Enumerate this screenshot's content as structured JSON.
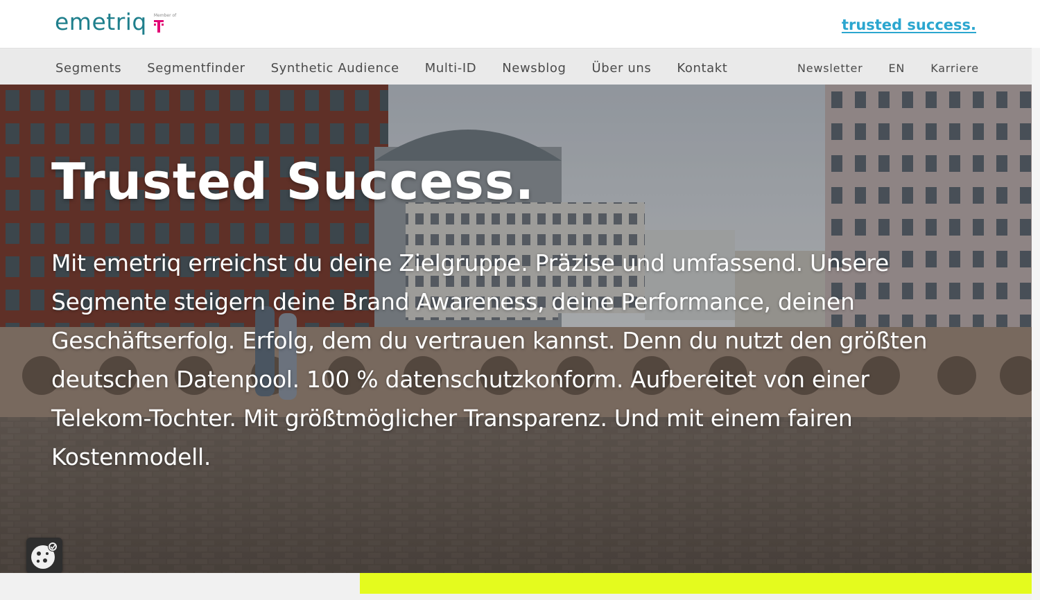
{
  "brand": {
    "logo_text": "emetriq",
    "member_of": "Member of",
    "tagline": "trusted success."
  },
  "nav": {
    "main": [
      {
        "label": "Segments"
      },
      {
        "label": "Segmentfinder"
      },
      {
        "label": "Synthetic Audience"
      },
      {
        "label": "Multi-ID"
      },
      {
        "label": "Newsblog"
      },
      {
        "label": "Über uns"
      },
      {
        "label": "Kontakt"
      }
    ],
    "secondary": [
      {
        "label": "Newsletter"
      },
      {
        "label": "EN"
      },
      {
        "label": "Karriere"
      }
    ]
  },
  "hero": {
    "title": "Trusted Success.",
    "text": "Mit emetriq erreichst du deine Zielgruppe. Präzise und umfassend. Unsere Segmente steigern deine Brand Awareness, deine Performance, deinen Geschäftserfolg. Erfolg, dem du vertrauen kannst. Denn du nutzt den größten deutschen Datenpool. 100 % datenschutzkonform. Aufbereitet von einer Telekom-Tochter. Mit größtmöglicher Transparenz. Und mit einem fairen Kostenmodell."
  },
  "icons": {
    "cookie": "cookie-settings-icon",
    "telekom": "telekom-t-icon"
  },
  "colors": {
    "brand_teal": "#1f7f8c",
    "link_blue": "#2ba6cf",
    "telekom_magenta": "#e20074",
    "accent_lime": "#e4fb1e",
    "nav_bg": "#eaeaea"
  }
}
